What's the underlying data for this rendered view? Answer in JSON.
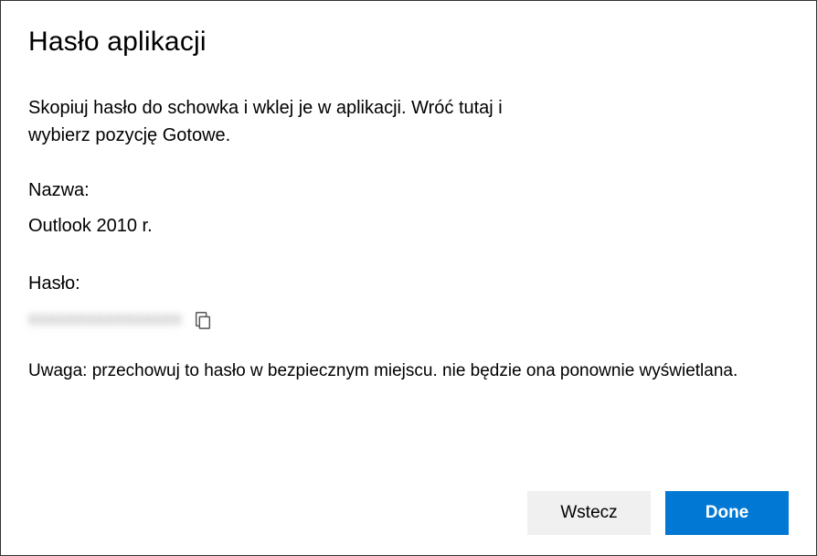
{
  "dialog": {
    "title": "Hasło aplikacji",
    "instructions": "Skopiuj hasło do schowka i wklej je w aplikacji. Wróć tutaj i wybierz pozycję Gotowe.",
    "name_label": "Nazwa:",
    "name_value": "Outlook 2010 r.",
    "password_label": "Hasło:",
    "password_value": "xxxxxxxxxxxxxxxx",
    "note": "Uwaga: przechowuj to hasło w bezpiecznym miejscu. nie będzie ona ponownie wyświetlana.",
    "back_button": "Wstecz",
    "done_button": "Done"
  }
}
